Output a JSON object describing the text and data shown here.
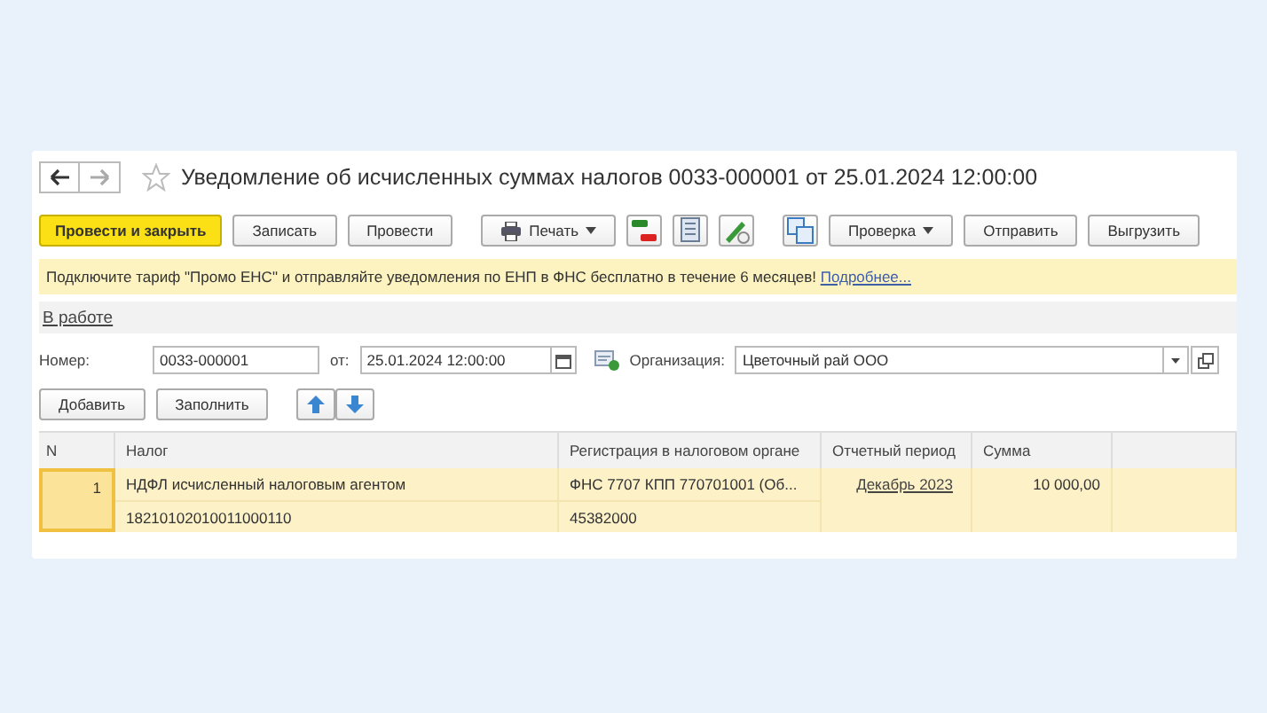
{
  "window": {
    "title": "Уведомление об исчисленных суммах налогов 0033-000001 от 25.01.2024 12:00:00",
    "favorite": false
  },
  "toolbar": [
    {
      "kind": "primary",
      "label": "Провести и закрыть"
    },
    {
      "kind": "text",
      "label": "Записать"
    },
    {
      "kind": "text",
      "label": "Провести"
    },
    {
      "kind": "print",
      "label": "Печать"
    },
    {
      "kind": "icon"
    },
    {
      "kind": "icon"
    },
    {
      "kind": "icon"
    },
    {
      "kind": "icon"
    },
    {
      "kind": "menu",
      "label": "Проверка"
    },
    {
      "kind": "text",
      "label": "Отправить"
    },
    {
      "kind": "text",
      "label": "Выгрузить"
    }
  ],
  "banner": {
    "text": "Подключите тариф \"Промо ЕНС\" и отправляйте уведомления по ЕНП в ФНС бесплатно в течение 6 месяцев!",
    "link": "Подробнее..."
  },
  "status_link": "В работе",
  "form": {
    "number_label": "Номер:",
    "number": "0033-000001",
    "date_label": "от:",
    "date": "25.01.2024 12:00:00",
    "org_label": "Организация:",
    "org": "Цветочный рай ООО"
  },
  "table_buttons": [
    "Добавить",
    "Заполнить"
  ],
  "table": {
    "columns": [
      "N",
      "Налог",
      "Регистрация в налоговом органе",
      "Отчетный период",
      "Сумма"
    ],
    "rows": [
      {
        "selected": true,
        "n": "1",
        "tax": "НДФЛ исчисленный налоговым агентом",
        "code": "18210102010011000110",
        "registration": "ФНС 7707 КПП 770701001 (Об...",
        "oktmo": "45382000",
        "period": "Декабрь 2023",
        "sum": "10 000,00"
      }
    ]
  }
}
